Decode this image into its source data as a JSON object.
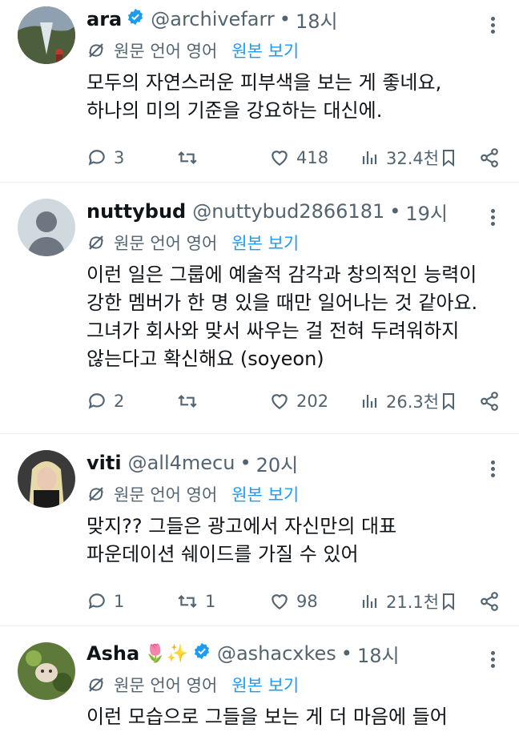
{
  "tweets": [
    {
      "name": "ara",
      "verified": true,
      "emoji": "",
      "handle": "@archivefarr",
      "time": "18시",
      "translate_label": "원문 언어 영어",
      "translate_link": "원본 보기",
      "lines": [
        "모두의 자연스러운 피부색을 보는 게 좋네요,",
        "하나의 미의 기준을 강요하는 대신에."
      ],
      "replies": "3",
      "retweets": "",
      "likes": "418",
      "views": "32.4천"
    },
    {
      "name": "nuttybud",
      "verified": false,
      "emoji": "",
      "handle": "@nuttybud2866181",
      "time": "19시",
      "translate_label": "원문 언어 영어",
      "translate_link": "원본 보기",
      "lines": [
        "이런 일은 그룹에 예술적 감각과 창의적인 능력이",
        "강한 멤버가 한 명 있을 때만 일어나는 것 같아요.",
        "그녀가 회사와 맞서 싸우는 걸 전혀 두려워하지",
        "않는다고 확신해요 (soyeon)"
      ],
      "replies": "2",
      "retweets": "",
      "likes": "202",
      "views": "26.3천"
    },
    {
      "name": "viti",
      "verified": false,
      "emoji": "",
      "handle": "@all4mecu",
      "time": "20시",
      "translate_label": "원문 언어 영어",
      "translate_link": "원본 보기",
      "lines": [
        "맞지?? 그들은 광고에서 자신만의 대표",
        "파운데이션 쉐이드를 가질 수 있어"
      ],
      "replies": "1",
      "retweets": "1",
      "likes": "98",
      "views": "21.1천"
    },
    {
      "name": "Asha",
      "verified": true,
      "emoji": "🌷✨",
      "handle": "@ashacxkes",
      "time": "18시",
      "translate_label": "원문 언어 영어",
      "translate_link": "원본 보기",
      "lines": [
        "이런 모습으로 그들을 보는 게 더 마음에 들어"
      ],
      "replies": "",
      "retweets": "",
      "likes": "",
      "views": ""
    }
  ],
  "dot": "•",
  "colors": {
    "accent": "#1d9bf0",
    "muted": "#536471",
    "text": "#0f1419"
  }
}
